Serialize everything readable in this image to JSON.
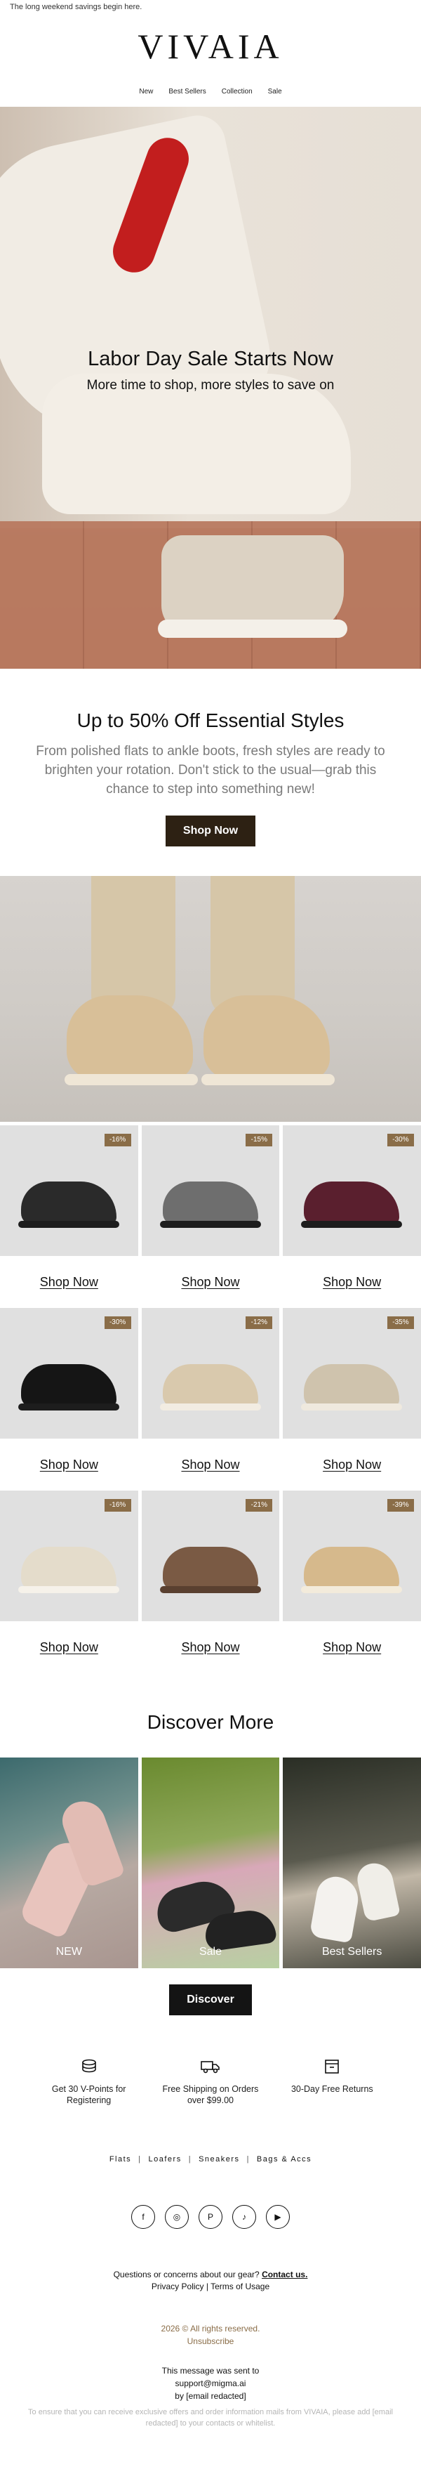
{
  "preheader": "The long weekend savings begin here.",
  "brand": {
    "logo": "VIVAIA"
  },
  "nav": [
    {
      "label": "New"
    },
    {
      "label": "Best Sellers"
    },
    {
      "label": "Collection"
    },
    {
      "label": "Sale"
    }
  ],
  "hero": {
    "title": "Labor Day Sale Starts Now",
    "subtitle": "More time to shop, more styles to save on"
  },
  "intro": {
    "heading": "Up to 50% Off Essential Styles",
    "body": "From polished flats to ankle boots, fresh styles are ready to brighten your rotation. Don't stick to the usual—grab this chance to step into something new!",
    "cta": "Shop Now"
  },
  "products": [
    {
      "badge": "-16%",
      "link": "Shop Now",
      "color": "#2a2a2a"
    },
    {
      "badge": "-15%",
      "link": "Shop Now",
      "color": "#6e6e6e"
    },
    {
      "badge": "-30%",
      "link": "Shop Now",
      "color": "#5a1f2e"
    },
    {
      "badge": "-30%",
      "link": "Shop Now",
      "color": "#151515"
    },
    {
      "badge": "-12%",
      "link": "Shop Now",
      "color": "#d9c9ad"
    },
    {
      "badge": "-35%",
      "link": "Shop Now",
      "color": "#cfc3ad"
    },
    {
      "badge": "-16%",
      "link": "Shop Now",
      "color": "#e4dccb"
    },
    {
      "badge": "-21%",
      "link": "Shop Now",
      "color": "#7a5a44"
    },
    {
      "badge": "-39%",
      "link": "Shop Now",
      "color": "#d6b98c"
    }
  ],
  "discover": {
    "title": "Discover More",
    "tiles": [
      {
        "label": "NEW"
      },
      {
        "label": "Sale"
      },
      {
        "label": "Best Sellers"
      }
    ],
    "cta": "Discover"
  },
  "perks": [
    {
      "icon": "coins-icon",
      "text": "Get 30 V-Points for Registering"
    },
    {
      "icon": "truck-icon",
      "text": "Free Shipping on Orders over $99.00"
    },
    {
      "icon": "return-box-icon",
      "text": "30-Day Free Returns"
    }
  ],
  "categories": [
    {
      "label": "Flats"
    },
    {
      "label": "Loafers"
    },
    {
      "label": "Sneakers"
    },
    {
      "label": "Bags & Accs"
    }
  ],
  "social": [
    {
      "icon": "facebook-icon",
      "glyph": "f"
    },
    {
      "icon": "instagram-icon",
      "glyph": "◎"
    },
    {
      "icon": "pinterest-icon",
      "glyph": "P"
    },
    {
      "icon": "tiktok-icon",
      "glyph": "♪"
    },
    {
      "icon": "youtube-icon",
      "glyph": "▶"
    }
  ],
  "footer": {
    "question": "Questions or concerns about our gear?",
    "contact_link": "Contact us.",
    "privacy": "Privacy Policy",
    "terms": "Terms of Usage",
    "copyright": "2026 © All rights reserved.",
    "unsubscribe": "Unsubscribe",
    "sent_line": "This message was sent to",
    "sent_email": "support@migma.ai",
    "sent_by": "by [email redacted]",
    "fine_print": "To ensure that you can receive exclusive offers and order information mails from VIVAIA, please add [email redacted] to your contacts or whitelist."
  },
  "colors": {
    "accent_brown": "#8a6d48",
    "button_brown": "#2d2113",
    "button_black": "#141414"
  }
}
